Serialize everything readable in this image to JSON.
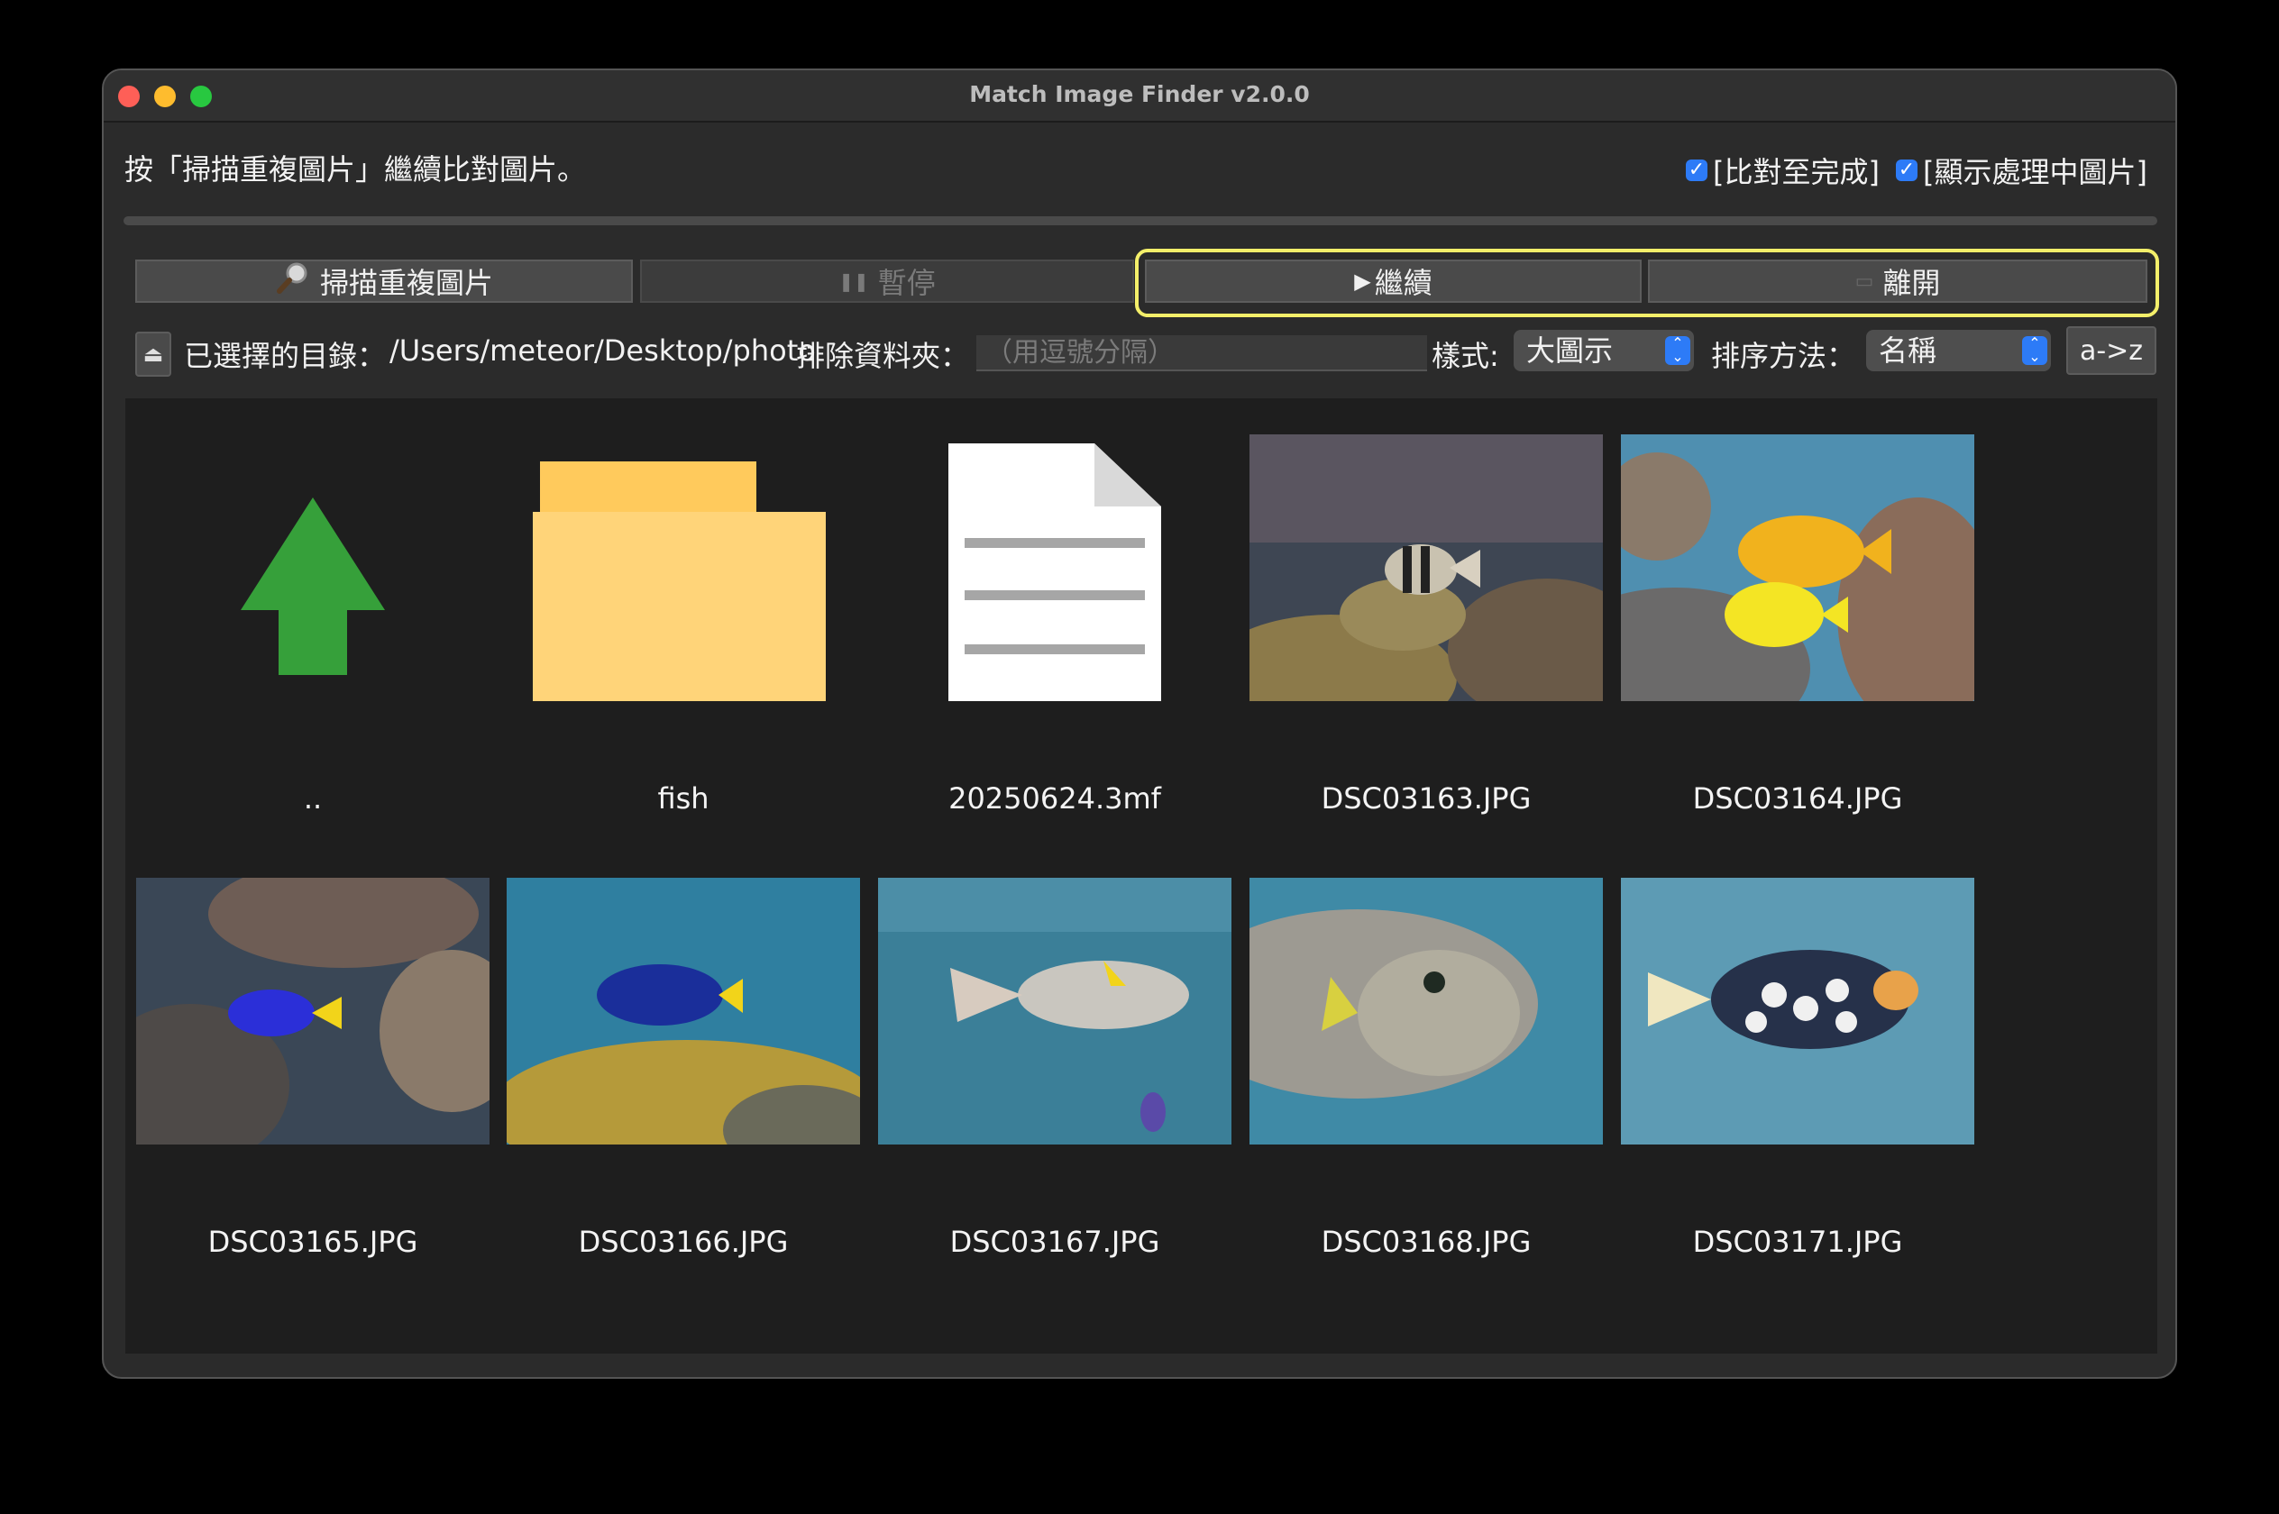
{
  "window": {
    "title": "Match Image Finder v2.0.0"
  },
  "status": {
    "message": "按「掃描重複圖片」繼續比對圖片。",
    "check_compare_label": "[比對至完成]",
    "check_show_label": "[顯示處理中圖片]",
    "check_compare_checked": true,
    "check_show_checked": true
  },
  "toolbar": {
    "scan_label": "掃描重複圖片",
    "pause_label": "暫停",
    "continue_label": "繼續",
    "exit_label": "離開",
    "scan_icon": "magnifier-icon",
    "pause_icon": "pause-icon",
    "continue_icon": "play-icon",
    "exit_icon": "exit-icon"
  },
  "directory": {
    "selected_label": "已選擇的目錄：",
    "path": "/Users/meteor/Desktop/photo",
    "exclude_label": "排除資料夾：",
    "exclude_placeholder": "（用逗號分隔）",
    "style_label": "樣式:",
    "style_value": "大圖示",
    "sort_label": "排序方法：",
    "sort_value": "名稱",
    "sort_order": "a->z"
  },
  "items": [
    {
      "name": "..",
      "kind": "parent-up"
    },
    {
      "name": "fish",
      "kind": "folder"
    },
    {
      "name": "20250624.3mf",
      "kind": "file"
    },
    {
      "name": "DSC03163.JPG",
      "kind": "image"
    },
    {
      "name": "DSC03164.JPG",
      "kind": "image"
    },
    {
      "name": "DSC03165.JPG",
      "kind": "image"
    },
    {
      "name": "DSC03166.JPG",
      "kind": "image"
    },
    {
      "name": "DSC03167.JPG",
      "kind": "image"
    },
    {
      "name": "DSC03168.JPG",
      "kind": "image"
    },
    {
      "name": "DSC03171.JPG",
      "kind": "image"
    }
  ],
  "colors": {
    "accent": "#2d7bf7",
    "highlight": "#f4ef6a",
    "folder": "#ffd479",
    "up_arrow": "#36a03a"
  }
}
